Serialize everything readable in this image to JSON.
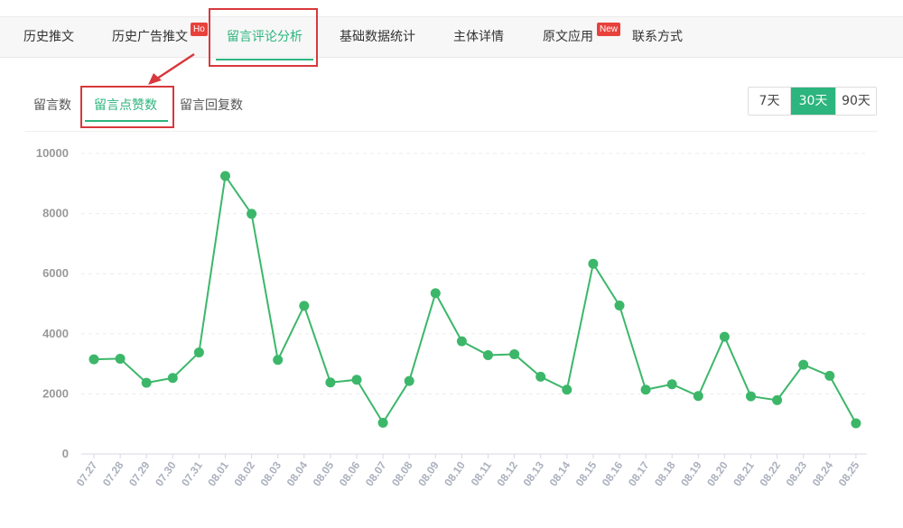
{
  "top_tabs": [
    {
      "label": "历史推文",
      "active": false
    },
    {
      "label": "历史广告推文",
      "active": false,
      "badge": "Ho"
    },
    {
      "label": "留言评论分析",
      "active": true
    },
    {
      "label": "基础数据统计",
      "active": false
    },
    {
      "label": "主体详情",
      "active": false
    },
    {
      "label": "原文应用",
      "active": false,
      "badge": "New"
    },
    {
      "label": "联系方式",
      "active": false
    }
  ],
  "sub_tabs": [
    {
      "label": "留言数",
      "active": false
    },
    {
      "label": "留言点赞数",
      "active": true
    },
    {
      "label": "留言回复数",
      "active": false
    }
  ],
  "range_buttons": [
    {
      "label": "7天",
      "active": false
    },
    {
      "label": "30天",
      "active": true
    },
    {
      "label": "90天",
      "active": false
    }
  ],
  "colors": {
    "accent": "#2cb57e",
    "line": "#3cb76a",
    "highlight": "#d8383c",
    "badge": "#e8413c"
  },
  "chart_data": {
    "type": "line",
    "ylim": [
      0,
      10000
    ],
    "y_ticks": [
      "0",
      "2000",
      "4000",
      "6000",
      "8000",
      "10000"
    ],
    "categories": [
      "07.27",
      "07.28",
      "07.29",
      "07.30",
      "07.31",
      "08.01",
      "08.02",
      "08.03",
      "08.04",
      "08.05",
      "08.06",
      "08.07",
      "08.08",
      "08.09",
      "08.10",
      "08.11",
      "08.12",
      "08.13",
      "08.14",
      "08.15",
      "08.16",
      "08.17",
      "08.18",
      "08.19",
      "08.20",
      "08.21",
      "08.22",
      "08.23",
      "08.24",
      "08.25"
    ],
    "series": [
      {
        "values": [
          3150,
          3170,
          2370,
          2530,
          3380,
          9250,
          7990,
          3130,
          4930,
          2380,
          2470,
          1040,
          2430,
          5350,
          3750,
          3290,
          3320,
          2570,
          2140,
          6330,
          4940,
          2140,
          2320,
          1930,
          3900,
          1920,
          1790,
          2970,
          2600,
          1020
        ]
      }
    ],
    "grid": true
  }
}
